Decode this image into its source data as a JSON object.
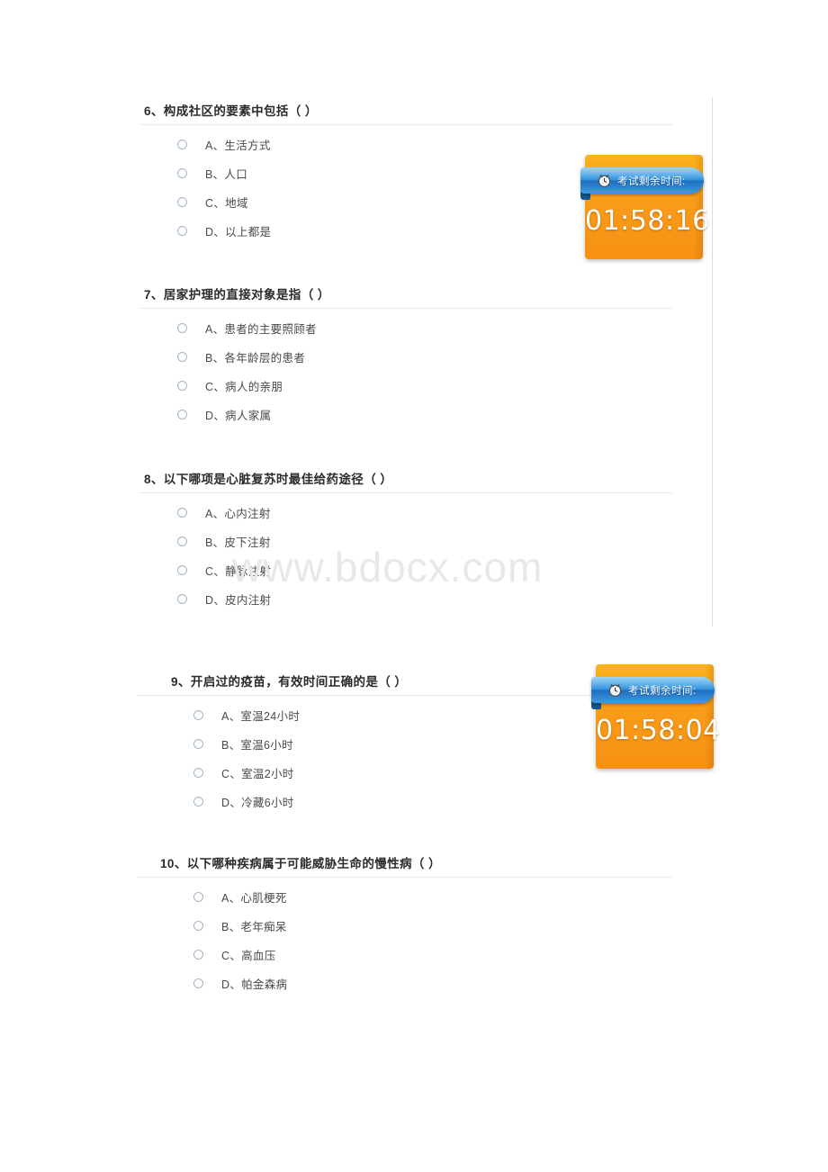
{
  "watermark": {
    "text": "www.bdocx.com"
  },
  "timers": [
    {
      "label": "考试剩余时间:",
      "value": "01:58:16",
      "icon": "clock-icon"
    },
    {
      "label": "考试剩余时间:",
      "value": "01:58:04",
      "icon": "clock-icon"
    }
  ],
  "questions": [
    {
      "number": "6",
      "title": "6、构成社区的要素中包括（  ）",
      "options": [
        {
          "key": "A",
          "label": "A、生活方式"
        },
        {
          "key": "B",
          "label": "B、人口"
        },
        {
          "key": "C",
          "label": "C、地域"
        },
        {
          "key": "D",
          "label": "D、以上都是"
        }
      ]
    },
    {
      "number": "7",
      "title": "7、居家护理的直接对象是指（  ）",
      "options": [
        {
          "key": "A",
          "label": "A、患者的主要照顾者"
        },
        {
          "key": "B",
          "label": "B、各年龄层的患者"
        },
        {
          "key": "C",
          "label": "C、病人的亲朋"
        },
        {
          "key": "D",
          "label": "D、病人家属"
        }
      ]
    },
    {
      "number": "8",
      "title": "8、以下哪项是心脏复苏时最佳给药途径（  ）",
      "options": [
        {
          "key": "A",
          "label": "A、心内注射"
        },
        {
          "key": "B",
          "label": "B、皮下注射"
        },
        {
          "key": "C",
          "label": "C、静脉注射"
        },
        {
          "key": "D",
          "label": "D、皮内注射"
        }
      ]
    },
    {
      "number": "9",
      "title": "9、开启过的疫苗，有效时间正确的是（  ）",
      "options": [
        {
          "key": "A",
          "label": "A、室温24小时"
        },
        {
          "key": "B",
          "label": "B、室温6小时"
        },
        {
          "key": "C",
          "label": "C、室温2小时"
        },
        {
          "key": "D",
          "label": "D、冷藏6小时"
        }
      ]
    },
    {
      "number": "10",
      "title": "10、以下哪种疾病属于可能威胁生命的慢性病（  ）",
      "options": [
        {
          "key": "A",
          "label": "A、心肌梗死"
        },
        {
          "key": "B",
          "label": "B、老年痴呆"
        },
        {
          "key": "C",
          "label": "C、高血压"
        },
        {
          "key": "D",
          "label": "D、帕金森病"
        }
      ]
    }
  ],
  "colors": {
    "timer_orange": "#f89c18",
    "timer_blue": "#2f8fdc",
    "rule": "#e9edf1",
    "right_rule": "#cfe0ea",
    "watermark": "#e8e8e8"
  }
}
